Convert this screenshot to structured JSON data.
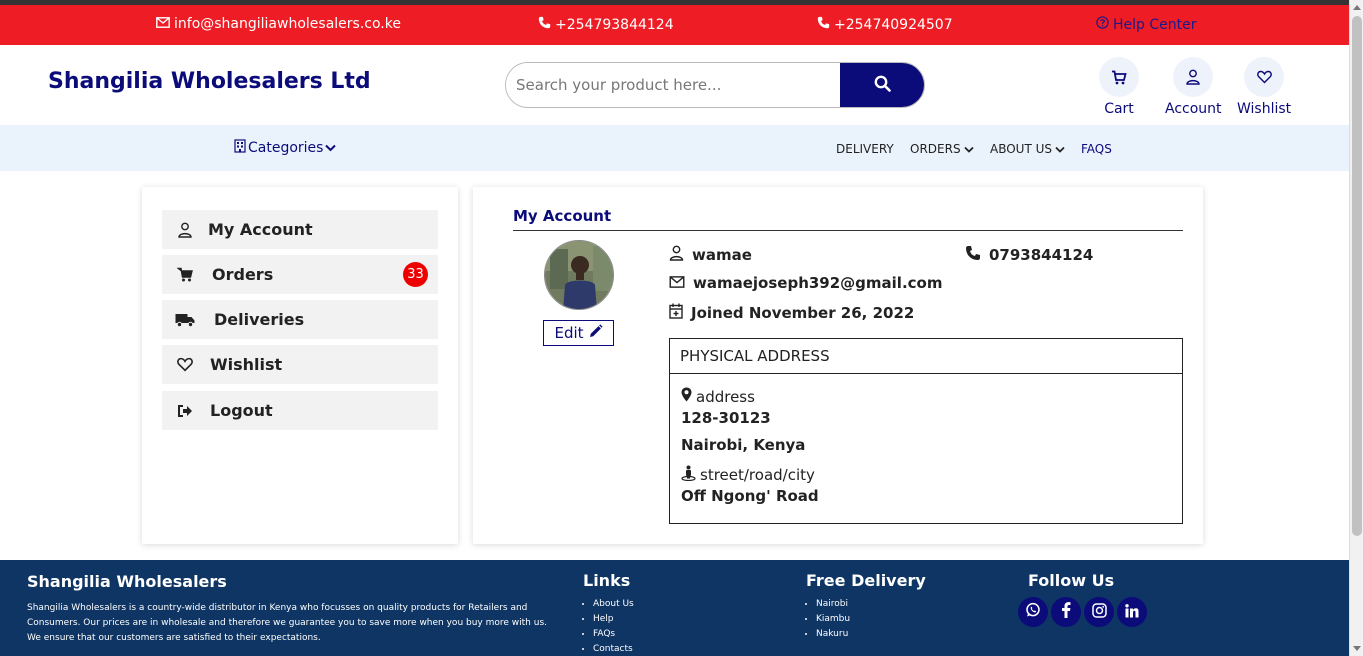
{
  "topbar": {
    "email": "info@shangiliawholesalers.co.ke",
    "phone1": "+254793844124",
    "phone2": "+254740924507",
    "help": "Help Center"
  },
  "header": {
    "brand": "Shangilia Wholesalers Ltd",
    "search_placeholder": "Search your product here...",
    "cart": "Cart",
    "account": "Account",
    "wishlist": "Wishlist"
  },
  "nav": {
    "categories": "Categories",
    "delivery": "DELIVERY",
    "orders": "ORDERS",
    "about": "ABOUT US",
    "faqs": "FAQS"
  },
  "sidebar": {
    "items": [
      {
        "label": "My Account",
        "icon": "user-icon"
      },
      {
        "label": "Orders",
        "icon": "cart-icon",
        "badge": "33"
      },
      {
        "label": "Deliveries",
        "icon": "truck-icon"
      },
      {
        "label": "Wishlist",
        "icon": "heart-icon"
      },
      {
        "label": "Logout",
        "icon": "logout-icon"
      }
    ]
  },
  "account": {
    "title": "My Account",
    "edit": "Edit",
    "username": "wamae",
    "phone": "0793844124",
    "email": "wamaejoseph392@gmail.com",
    "joined": "Joined November 26, 2022",
    "address_title": "PHYSICAL ADDRESS",
    "address_label": "address",
    "address_line1": "128-30123",
    "address_line2": "Nairobi, Kenya",
    "street_label": "street/road/city",
    "street_value": "Off Ngong' Road"
  },
  "footer": {
    "brand": "Shangilia Wholesalers",
    "description": "Shangilia Wholesalers is a country-wide distributor in Kenya who focusses on quality products for Retailers and Consumers. Our prices are in wholesale and therefore we guarantee you to save more when you buy more with us. We ensure that our customers are satisfied to their expectations.",
    "links_title": "Links",
    "links": [
      "About Us",
      "Help",
      "FAQs",
      "Contacts"
    ],
    "delivery_title": "Free Delivery",
    "delivery_areas": [
      "Nairobi",
      "Kiambu",
      "Nakuru"
    ],
    "follow_title": "Follow Us"
  },
  "colors": {
    "topbar": "#ee1c24",
    "brand_blue": "#0b0b7a",
    "nav_bg": "#eaf3fc",
    "footer_bg": "#0e3563",
    "badge": "#ee0000"
  }
}
